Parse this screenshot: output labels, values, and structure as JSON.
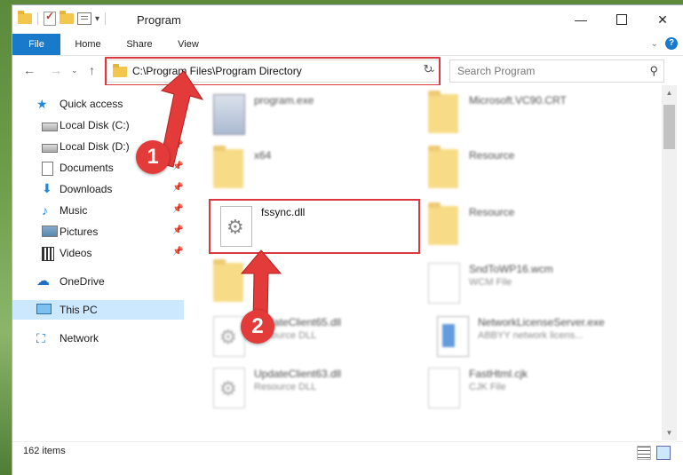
{
  "window": {
    "title": "Program",
    "quick_access_toolbar_dropdown": "▾",
    "controls": {
      "minimize": "—",
      "maximize": "",
      "close": "✕"
    }
  },
  "ribbon": {
    "tabs": [
      {
        "label": "File",
        "active": true
      },
      {
        "label": "Home"
      },
      {
        "label": "Share"
      },
      {
        "label": "View"
      }
    ],
    "expand_glyph": "⌄",
    "help_glyph": "?"
  },
  "address": {
    "path": "C:\\Program Files\\Program Directory",
    "dropdown_glyph": "⌄",
    "refresh_glyph": "↻",
    "back_glyph": "←",
    "forward_glyph": "→",
    "recent_glyph": "⌄",
    "up_glyph": "↑"
  },
  "search": {
    "placeholder": "Search Program",
    "icon_glyph": "⚲"
  },
  "nav_pane": {
    "pin_glyph": "📌",
    "items": [
      {
        "label": "Quick access",
        "icon": "star-icon",
        "glyph": "★"
      },
      {
        "label": "Local Disk (C:)",
        "icon": "disk-icon",
        "pinned": true
      },
      {
        "label": "Local Disk (D:)",
        "icon": "disk-icon",
        "pinned": true
      },
      {
        "label": "Documents",
        "icon": "document-icon",
        "pinned": true
      },
      {
        "label": "Downloads",
        "icon": "download-icon",
        "glyph": "⬇",
        "pinned": true
      },
      {
        "label": "Music",
        "icon": "music-icon",
        "glyph": "♪",
        "pinned": true
      },
      {
        "label": "Pictures",
        "icon": "pictures-icon",
        "pinned": true
      },
      {
        "label": "Videos",
        "icon": "videos-icon",
        "pinned": true
      },
      {
        "label": "OneDrive",
        "icon": "cloud-icon",
        "glyph": "☁"
      },
      {
        "label": "This PC",
        "icon": "computer-icon",
        "selected": true
      },
      {
        "label": "Network",
        "icon": "network-icon",
        "glyph": "⛶"
      }
    ]
  },
  "files": [
    {
      "name": "program.exe",
      "type": "",
      "icon": "exe-icon",
      "blurred": true
    },
    {
      "name": "Microsoft.VC90.CRT",
      "type": "",
      "icon": "folder-icon",
      "blurred": true
    },
    {
      "name": "x64",
      "type": "",
      "icon": "folder-icon",
      "blurred": true
    },
    {
      "name": "Resource",
      "type": "",
      "icon": "folder-icon",
      "blurred": true
    },
    {
      "name": "fssync.dll",
      "type": "",
      "icon": "dll-icon",
      "blurred": false
    },
    {
      "name": "Resource",
      "type": "",
      "icon": "folder-icon",
      "blurred": true
    },
    {
      "name": "",
      "type": "",
      "icon": "folder-icon",
      "blurred": true
    },
    {
      "name": "SndToWP16.wcm",
      "type": "WCM File",
      "icon": "page-icon",
      "blurred": true
    },
    {
      "name": "UpdateClient65.dll",
      "type": "Resource DLL",
      "icon": "dll-icon",
      "blurred": true
    },
    {
      "name": "NetworkLicenseServer.exe",
      "type": "ABBYY network licens...",
      "icon": "network-exe-icon",
      "blurred": true
    },
    {
      "name": "UpdateClient63.dll",
      "type": "Resource DLL",
      "icon": "dll-icon",
      "blurred": true
    },
    {
      "name": "FastHtml.cjk",
      "type": "CJK File",
      "icon": "page-icon",
      "blurred": true
    }
  ],
  "status": {
    "item_count": "162 items"
  },
  "callouts": {
    "one": "1",
    "two": "2"
  },
  "colors": {
    "accent": "#1979ca",
    "highlight": "#d9383f",
    "selected_bg": "#cce8ff"
  }
}
